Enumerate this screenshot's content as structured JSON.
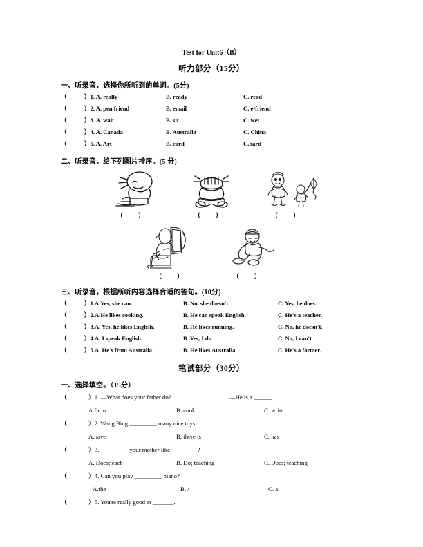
{
  "document": {
    "title": "Test for Unit6（B）"
  },
  "listening": {
    "part_title": "听力部分（15分）",
    "section1": {
      "heading": "一、听录音，选择你所听到的单词。(5分)",
      "bracket_open": "（",
      "bracket_close": "）",
      "questions": [
        {
          "num": "）1. A. really",
          "b": "B. ready",
          "c": "C. read"
        },
        {
          "num": "）2. A. pen friend",
          "b": "B. email",
          "c": "C. e-friend"
        },
        {
          "num": "）3. A. wait",
          "b": "B. sit",
          "c": "C. wet"
        },
        {
          "num": "）4. A. Canada",
          "b": "B. Australia",
          "c": "C. China"
        },
        {
          "num": "）5. A. Art",
          "b": "B. card",
          "c": "C.hard"
        }
      ]
    },
    "section2": {
      "heading": "二、听录音，给下列图片排序。(5 分)",
      "row1": [
        {
          "icon": "boy-writing-at-desk-drawing",
          "answer": "（  ）"
        },
        {
          "icon": "child-sitting-drawing",
          "answer": "（  ）"
        },
        {
          "icon": "children-flying-kite-drawing",
          "answer": "（  ）"
        }
      ],
      "row2": [
        {
          "icon": "person-playing-piano-drawing",
          "answer": "（  ）"
        },
        {
          "icon": "boy-running-drawing",
          "answer": "（  ）"
        }
      ]
    },
    "section3": {
      "heading": "三、听录音，根据所听内容选择合适的答句。(10分)",
      "questions": [
        {
          "num": "）1.A.Yes, she can.",
          "b": "B. No, she doesn't",
          "c": "C. Yes, he does."
        },
        {
          "num": "）2.A.He likes cooking.",
          "b": "B. He can speak English.",
          "c": "C. He's a teacher."
        },
        {
          "num": "）3.A. Yes, he likes English.",
          "b": "B. He likes running.",
          "c": "C. No, he doesn't."
        },
        {
          "num": "）4.A. I speak English.",
          "b": "B. Yes, I do .",
          "c": "C. No, I can't."
        },
        {
          "num": "）5.A. He's from Australia.",
          "b": "B. He likes Australia.",
          "c": "C. He's a farmer."
        }
      ]
    }
  },
  "written": {
    "part_title": "笔试部分（30分）",
    "section1": {
      "heading": "一、选择填空。（15分）",
      "questions": [
        {
          "stem_pre": "）1. —What does your father do?",
          "stem_post": "—He is a ______.",
          "a": "A.farm",
          "b": "B. cook",
          "c": "C. write"
        },
        {
          "stem_pre": "）2. Wang Bing _________ many nice toys.",
          "stem_post": "",
          "a": "A.have",
          "b": "B. there is",
          "c": "C. has"
        },
        {
          "stem_pre": "）3. _________ your mother like ________ ?",
          "stem_post": "",
          "a": "A. Does;teach",
          "b": "B. Do; teaching",
          "c": "C. Does; teaching"
        },
        {
          "stem_pre": "）4. Can you play _________ piano?",
          "stem_post": "",
          "a": "A.the",
          "b": "B. /",
          "c": "C. a"
        },
        {
          "stem_pre": "）5. You're really good at _______.",
          "stem_post": "",
          "a": "",
          "b": "",
          "c": ""
        }
      ]
    }
  }
}
